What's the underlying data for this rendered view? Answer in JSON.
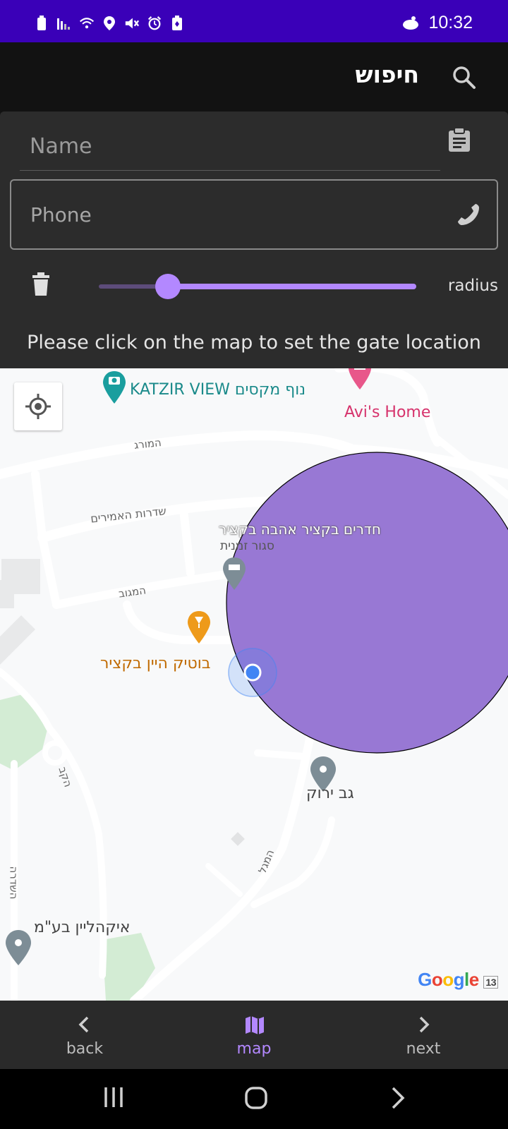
{
  "status_bar": {
    "time": "10:32",
    "background": "#3a00b8",
    "icons": [
      "battery-icon",
      "signal-icon",
      "wifi-icon",
      "location-icon",
      "mute-icon",
      "alarm-icon",
      "battery-saver-icon",
      "notification-icon"
    ]
  },
  "app_bar": {
    "title": "חיפוש",
    "search_icon": "search-icon"
  },
  "form": {
    "name_placeholder": "Name",
    "phone_placeholder": "Phone",
    "radius_label": "radius",
    "radius_value": 0.2,
    "hint": "Please click on the map to set the gate location",
    "accent": "#b388ff"
  },
  "map": {
    "labels": {
      "katzir_view": "KATZIR VIEW נוף מקסים",
      "avis_home": "Avi's Home",
      "street_morag": "המורג",
      "street_sderot": "שדרות האמירים",
      "hotel_title": "חדרים בקציר אהבה בקציר",
      "hotel_sub": "סגור זמנית",
      "street_magov": "המגוב",
      "wine_boutique": "בוטיק היין בקציר",
      "gav_yarok": "גב ירוק",
      "street_hakav": "הקב",
      "street_hamagal": "המגל",
      "street_hasade": "השדרה",
      "ikaliyin": "איקהליין בע\"מ",
      "google": "Google",
      "google_suffix": "13"
    },
    "circle_color": "#8f6cd0"
  },
  "bottom_nav": {
    "items": [
      {
        "label": "back",
        "icon": "chevron-left-icon",
        "active": false
      },
      {
        "label": "map",
        "icon": "map-icon",
        "active": true
      },
      {
        "label": "next",
        "icon": "chevron-right-icon",
        "active": false
      }
    ]
  },
  "system_nav": {
    "buttons": [
      "recents-icon",
      "home-icon",
      "back-icon"
    ]
  }
}
